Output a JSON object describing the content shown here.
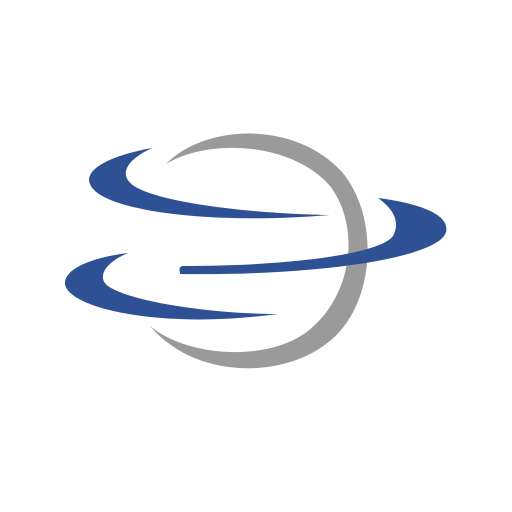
{
  "logo": {
    "icon": "globe-orbit-logo-icon",
    "colors": {
      "background": "#ffffff",
      "globe_arc": "#9a9a9a",
      "swoosh": "#2e5196"
    }
  }
}
